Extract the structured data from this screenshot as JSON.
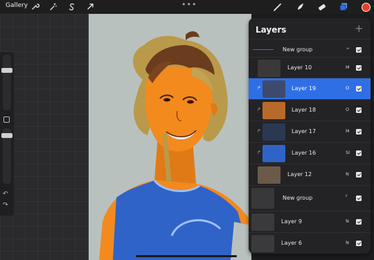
{
  "toolbar": {
    "gallery_label": "Gallery",
    "more_label": "•••",
    "left_icons": [
      "wrench-icon",
      "magic-wand-icon",
      "selection-s-icon",
      "transform-arrow-icon"
    ],
    "right_icons": [
      "brush-icon",
      "smudge-icon",
      "eraser-icon",
      "layers-icon"
    ],
    "active_color": "#e8412a"
  },
  "sidebar": {
    "undo_label": "↶",
    "redo_label": "↷"
  },
  "layers_panel": {
    "title": "Layers",
    "add_label": "+",
    "rows": [
      {
        "name": "New group",
        "type": "group",
        "expanded": true,
        "blend": "",
        "visible": true
      },
      {
        "name": "Layer 10",
        "type": "layer",
        "blend": "M",
        "visible": true
      },
      {
        "name": "Layer 19",
        "type": "layer",
        "blend": "O",
        "visible": true,
        "selected": true
      },
      {
        "name": "Layer 18",
        "type": "layer",
        "blend": "O",
        "visible": true
      },
      {
        "name": "Layer 17",
        "type": "layer",
        "blend": "M",
        "visible": true
      },
      {
        "name": "Layer 16",
        "type": "layer",
        "blend": "SI",
        "visible": true
      },
      {
        "name": "Layer 12",
        "type": "layer",
        "blend": "N",
        "visible": true
      },
      {
        "name": "New group",
        "type": "group",
        "expanded": false,
        "blend": "",
        "visible": true
      },
      {
        "name": "Layer 9",
        "type": "layer",
        "blend": "N",
        "visible": true
      },
      {
        "name": "Layer 6",
        "type": "layer",
        "blend": "N",
        "visible": true
      }
    ]
  },
  "colors": {
    "canvas_bg": "#b9c1bf",
    "selected_row": "#2f6fe6",
    "skin": "#f28a1e",
    "hair": "#6b3c1d",
    "shirt": "#2f63c8"
  }
}
